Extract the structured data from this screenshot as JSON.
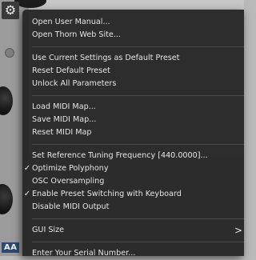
{
  "menu": {
    "sections": [
      [
        {
          "label": "Open User Manual...",
          "checked": false
        },
        {
          "label": "Open Thorn Web Site...",
          "checked": false
        }
      ],
      [
        {
          "label": "Use Current Settings as Default Preset",
          "checked": false
        },
        {
          "label": "Reset Default Preset",
          "checked": false
        },
        {
          "label": "Unlock All Parameters",
          "checked": false
        }
      ],
      [
        {
          "label": "Load MIDI Map...",
          "checked": false
        },
        {
          "label": "Save MIDI Map...",
          "checked": false
        },
        {
          "label": "Reset MIDI Map",
          "checked": false
        }
      ],
      [
        {
          "label": "Set Reference Tuning Frequency [440.0000]...",
          "checked": false
        },
        {
          "label": "Optimize Polyphony",
          "checked": true
        },
        {
          "label": "OSC Oversampling",
          "checked": false
        },
        {
          "label": "Enable Preset Switching with Keyboard",
          "checked": true
        },
        {
          "label": "Disable MIDI Output",
          "checked": false
        }
      ],
      [
        {
          "label": "GUI Size",
          "checked": false,
          "submenu": true
        }
      ],
      [
        {
          "label": "Enter Your Serial Number...",
          "checked": false
        }
      ]
    ],
    "check_mark": "✓",
    "submenu_arrow": ">"
  },
  "background": {
    "logo_fragment": "AA",
    "gear_icon": "gear-icon"
  },
  "colors": {
    "menu_bg": "#262626",
    "menu_text": "#e6e6e6",
    "separator": "#4b4b4b"
  }
}
